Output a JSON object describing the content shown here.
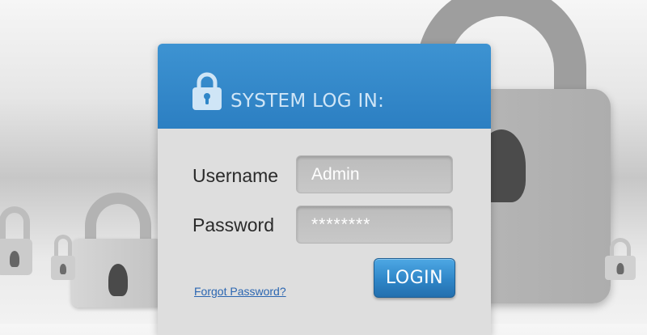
{
  "icons": {
    "header": "padlock-icon",
    "background": [
      "padlock-icon",
      "padlock-icon",
      "padlock-icon",
      "padlock-icon",
      "padlock-icon"
    ]
  },
  "colors": {
    "header_blue": "#2f86c8",
    "button_blue": "#2f86c8",
    "link_blue": "#2b66b1",
    "card_bg": "#dedede"
  },
  "login": {
    "title": "SYSTEM LOG IN:",
    "username_label": "Username",
    "username_value": "Admin",
    "password_label": "Password",
    "password_value": "********",
    "login_button": "LOGIN",
    "forgot_link": "Forgot Password?"
  }
}
